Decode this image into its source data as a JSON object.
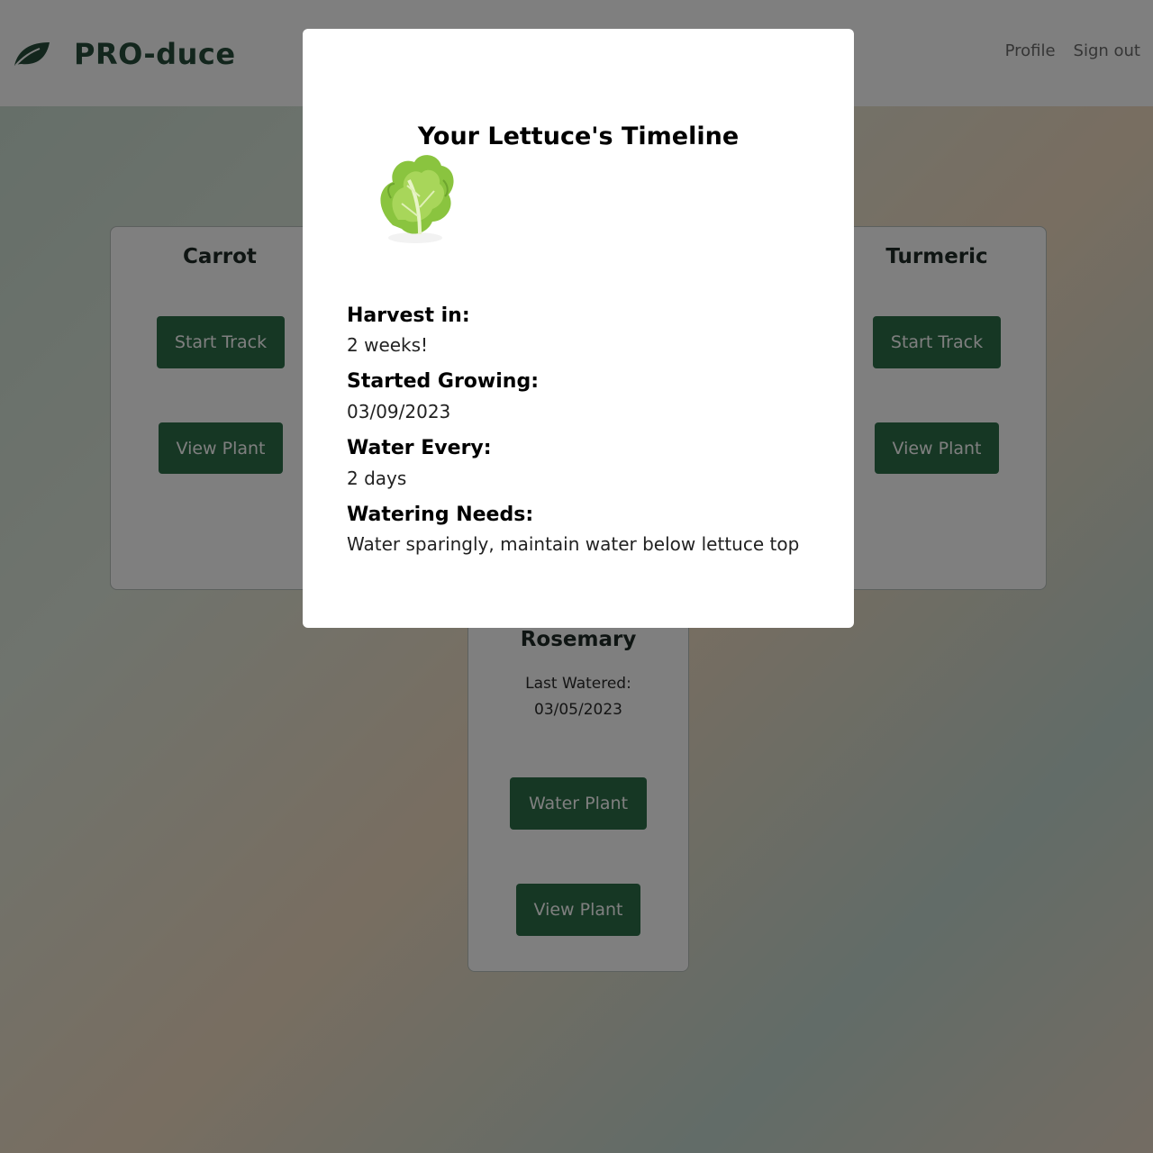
{
  "app": {
    "brand_name": "PRO-duce",
    "logo_icon": "leaf-icon",
    "nav": {
      "profile": "Profile",
      "sign_out": "Sign out"
    }
  },
  "colors": {
    "brand": "#264d3a",
    "button": "#2c6e49",
    "overlay": "rgba(0,0,0,0.5)"
  },
  "cards": {
    "carrot": {
      "title": "Carrot",
      "start_track": "Start Track",
      "view_plant": "View Plant"
    },
    "turmeric": {
      "title": "Turmeric",
      "start_track": "Start Track",
      "view_plant": "View Plant"
    },
    "rosemary": {
      "title": "Rosemary",
      "last_watered_label": "Last Watered:",
      "last_watered_value": "03/05/2023",
      "water_plant": "Water Plant",
      "view_plant": "View Plant"
    }
  },
  "modal": {
    "title": "Your Lettuce's Timeline",
    "image_icon": "lettuce-image",
    "harvest_label": "Harvest in:",
    "harvest_value": "2 weeks!",
    "started_label": "Started Growing:",
    "started_value": "03/09/2023",
    "water_every_label": "Water Every:",
    "water_every_value": "2 days",
    "watering_needs_label": "Watering Needs:",
    "watering_needs_value": "Water sparingly, maintain water below lettuce top"
  }
}
